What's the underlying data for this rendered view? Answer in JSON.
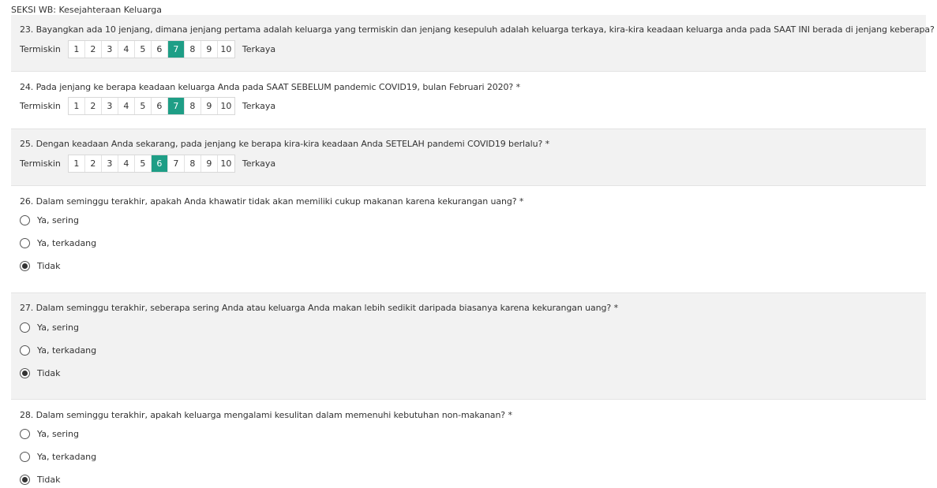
{
  "section": {
    "title": "SEKSI WB: Kesejahteraan Keluarga"
  },
  "scale": {
    "low_label": "Termiskin",
    "high_label": "Terkaya",
    "options": [
      "1",
      "2",
      "3",
      "4",
      "5",
      "6",
      "7",
      "8",
      "9",
      "10"
    ]
  },
  "questions": [
    {
      "title": "23. Bayangkan ada 10 jenjang, dimana jenjang pertama adalah keluarga yang termiskin dan jenjang kesepuluh adalah keluarga terkaya, kira-kira keadaan keluarga anda pada SAAT INI berada di jenjang keberapa? *",
      "selected": "7"
    },
    {
      "title": "24. Pada jenjang ke berapa keadaan keluarga Anda pada SAAT SEBELUM pandemic COVID19, bulan Februari 2020?  *",
      "selected": "7"
    },
    {
      "title": "25. Dengan keadaan Anda sekarang, pada jenjang ke berapa kira-kira keadaan Anda SETELAH pandemi COVID19 berlalu?  *",
      "selected": "6"
    },
    {
      "title": "26. Dalam seminggu terakhir, apakah Anda khawatir tidak akan memiliki cukup makanan karena kekurangan uang? *",
      "options": [
        "Ya, sering",
        "Ya, terkadang",
        "Tidak"
      ],
      "selected": "Tidak"
    },
    {
      "title": "27. Dalam seminggu terakhir, seberapa sering Anda atau keluarga Anda makan lebih sedikit daripada biasanya karena kekurangan uang? *",
      "options": [
        "Ya, sering",
        "Ya, terkadang",
        "Tidak"
      ],
      "selected": "Tidak"
    },
    {
      "title": "28. Dalam seminggu terakhir, apakah keluarga mengalami kesulitan dalam memenuhi kebutuhan non-makanan? *",
      "options": [
        "Ya, sering",
        "Ya, terkadang",
        "Tidak"
      ],
      "selected": "Tidak"
    }
  ],
  "colors": {
    "selected_bg": "#1e9e86",
    "shaded_bg": "#f2f2f2"
  }
}
